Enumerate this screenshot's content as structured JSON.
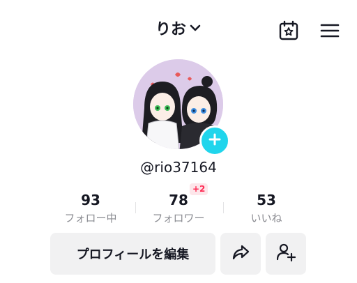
{
  "header": {
    "username": "りお",
    "icons": [
      "chevron-down-icon",
      "calendar-star-icon",
      "hamburger-menu-icon"
    ]
  },
  "profile": {
    "handle": "@rio37164"
  },
  "stats": [
    {
      "value": "93",
      "label": "フォロー中"
    },
    {
      "value": "78",
      "label": "フォロワー",
      "badge": "+2"
    },
    {
      "value": "53",
      "label": "いいね"
    }
  ],
  "actions": {
    "edit_label": "プロフィールを編集",
    "share_icon": "share-arrow-icon",
    "add_friend_icon": "add-user-icon"
  },
  "colors": {
    "accent_cyan": "#20d5ec",
    "badge_red": "#fe2c55",
    "badge_bg": "#fde6ea",
    "button_bg": "#f1f1f2",
    "avatar_bg": "#dccbe9",
    "muted_text": "#8a8b91"
  }
}
